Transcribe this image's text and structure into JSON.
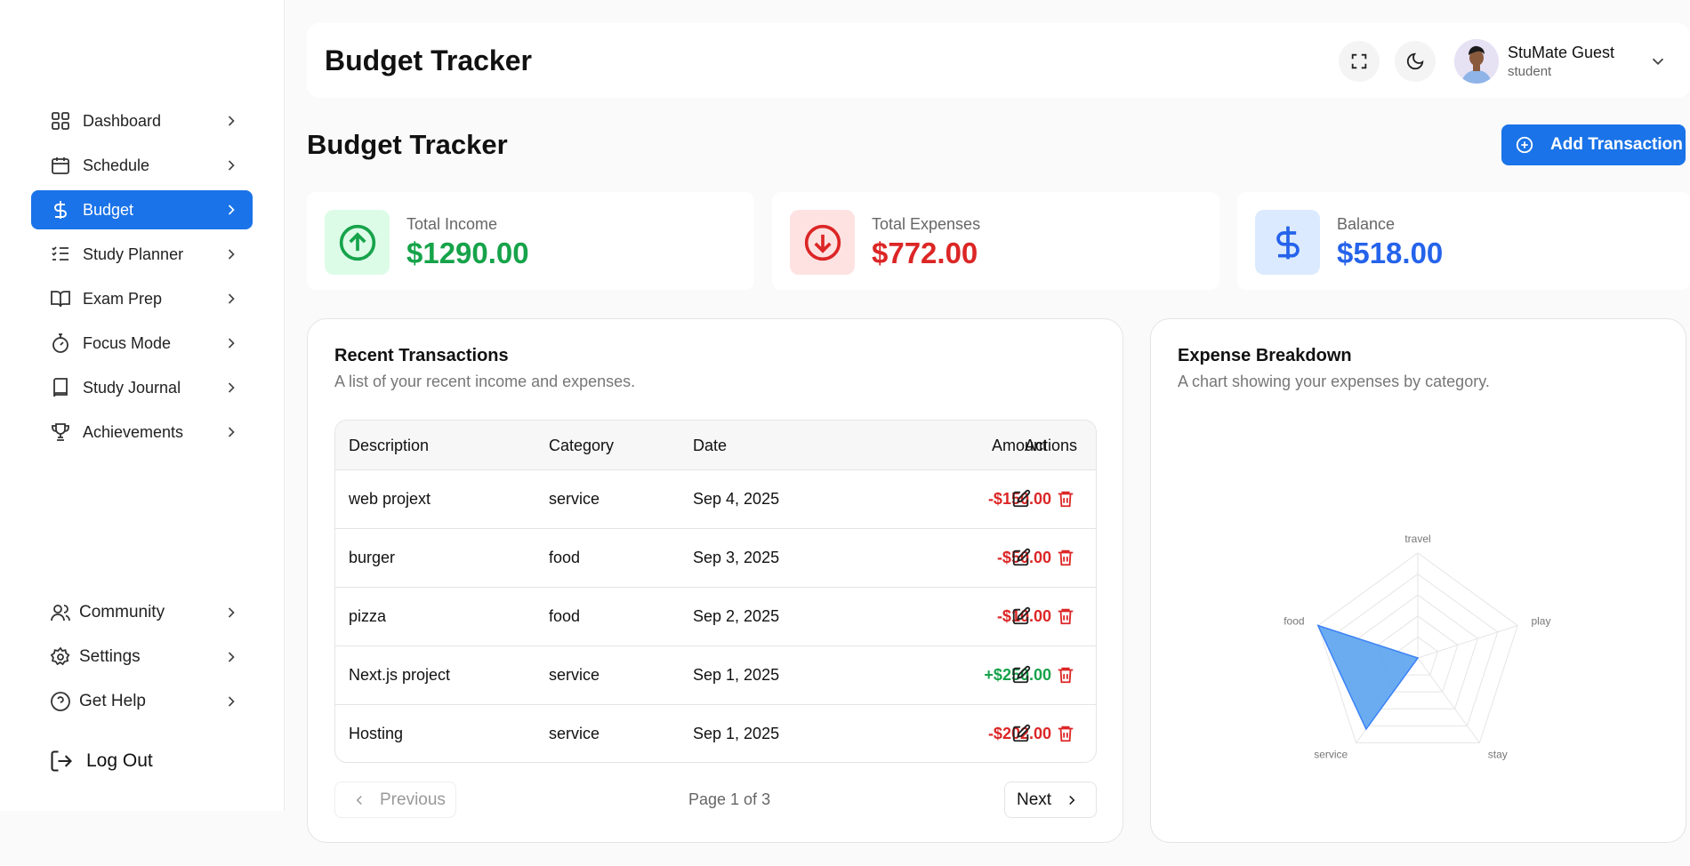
{
  "sidebar": {
    "items": [
      {
        "label": "Dashboard",
        "icon": "dashboard-grid-icon"
      },
      {
        "label": "Schedule",
        "icon": "calendar-icon"
      },
      {
        "label": "Budget",
        "icon": "dollar-icon",
        "active": true
      },
      {
        "label": "Study Planner",
        "icon": "checklist-icon"
      },
      {
        "label": "Exam Prep",
        "icon": "open-book-icon"
      },
      {
        "label": "Focus Mode",
        "icon": "stopwatch-icon"
      },
      {
        "label": "Study Journal",
        "icon": "journal-icon"
      },
      {
        "label": "Achievements",
        "icon": "trophy-icon"
      }
    ],
    "bottom_items": [
      {
        "label": "Community",
        "icon": "users-icon"
      },
      {
        "label": "Settings",
        "icon": "gear-icon"
      },
      {
        "label": "Get Help",
        "icon": "help-circle-icon"
      }
    ],
    "logout_label": "Log Out"
  },
  "header": {
    "title": "Budget Tracker",
    "user_name": "StuMate Guest",
    "user_role": "student"
  },
  "page": {
    "title": "Budget Tracker",
    "add_button_label": "Add Transaction"
  },
  "stats": {
    "income": {
      "label": "Total Income",
      "value": "$1290.00",
      "color": "#16a34a",
      "bg": "#dcfce7"
    },
    "expenses": {
      "label": "Total Expenses",
      "value": "$772.00",
      "color": "#dc2626",
      "bg": "#fee2e2"
    },
    "balance": {
      "label": "Balance",
      "value": "$518.00",
      "color": "#2563eb",
      "bg": "#dbeafe"
    }
  },
  "transactions": {
    "title": "Recent Transactions",
    "description": "A list of your recent income and expenses.",
    "columns": [
      "Description",
      "Category",
      "Date",
      "Amount",
      "Actions"
    ],
    "rows": [
      {
        "description": "web projext",
        "category": "service",
        "date": "Sep 4, 2025",
        "amount": "-$150.00",
        "type": "expense"
      },
      {
        "description": "burger",
        "category": "food",
        "date": "Sep 3, 2025",
        "amount": "-$50.00",
        "type": "expense"
      },
      {
        "description": "pizza",
        "category": "food",
        "date": "Sep 2, 2025",
        "amount": "-$10.00",
        "type": "expense"
      },
      {
        "description": "Next.js project",
        "category": "service",
        "date": "Sep 1, 2025",
        "amount": "+$250.00",
        "type": "income"
      },
      {
        "description": "Hosting",
        "category": "service",
        "date": "Sep 1, 2025",
        "amount": "-$202.00",
        "type": "expense"
      }
    ],
    "pagination": {
      "previous": "Previous",
      "info": "Page 1 of 3",
      "next": "Next"
    }
  },
  "breakdown": {
    "title": "Expense Breakdown",
    "description": "A chart showing your expenses by category."
  },
  "colors": {
    "accent": "#1a73e8",
    "expense": "#dc2626",
    "income": "#16a34a",
    "radar_fill": "#5ba3f0",
    "radar_stroke": "#3b82f6"
  },
  "chart_data": {
    "type": "radar",
    "categories": [
      "travel",
      "play",
      "stay",
      "service",
      "food"
    ],
    "values": [
      0,
      0,
      0,
      352,
      420
    ],
    "max": 420,
    "grid": true,
    "rings": 5
  }
}
